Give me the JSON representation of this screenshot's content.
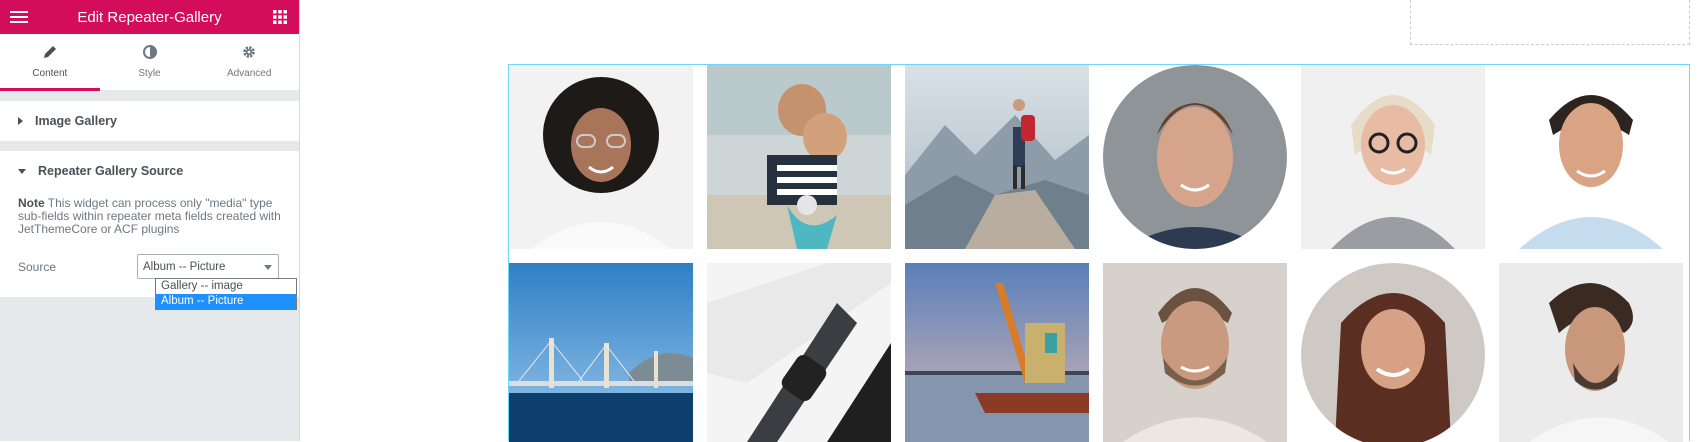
{
  "header": {
    "title": "Edit Repeater-Gallery",
    "menu_icon": "hamburger-icon",
    "apps_icon": "grid-icon"
  },
  "tabs": [
    {
      "label": "Content",
      "icon": "pencil-icon",
      "active": true
    },
    {
      "label": "Style",
      "icon": "half-circle-icon",
      "active": false
    },
    {
      "label": "Advanced",
      "icon": "gear-icon",
      "active": false
    }
  ],
  "sections": {
    "image_gallery": {
      "label": "Image Gallery",
      "expanded": false
    },
    "repeater_source": {
      "label": "Repeater Gallery Source",
      "expanded": true,
      "note_bold": "Note",
      "note_text": " This widget can process only \"media\" type sub-fields within repeater meta fields created with JetThemeCore or ACF plugins",
      "source_label": "Source",
      "source_value": "Album -- Picture",
      "source_options": [
        "Gallery -- image",
        "Album -- Picture"
      ]
    }
  },
  "colors": {
    "accent": "#d30c5c",
    "selected_option": "#1e90ff",
    "gallery_border": "#71d7f7"
  },
  "gallery": {
    "items": [
      {
        "subject": "woman-curly-hair"
      },
      {
        "subject": "couple-on-scooter"
      },
      {
        "subject": "hiker-on-mountain"
      },
      {
        "subject": "man-portrait"
      },
      {
        "subject": "woman-glasses"
      },
      {
        "subject": "man-smiling"
      },
      {
        "subject": "cable-bridge"
      },
      {
        "subject": "smartwatch-laptop"
      },
      {
        "subject": "harbor-crane"
      },
      {
        "subject": "man-bearded"
      },
      {
        "subject": "woman-long-hair"
      },
      {
        "subject": "man-profile"
      }
    ]
  }
}
